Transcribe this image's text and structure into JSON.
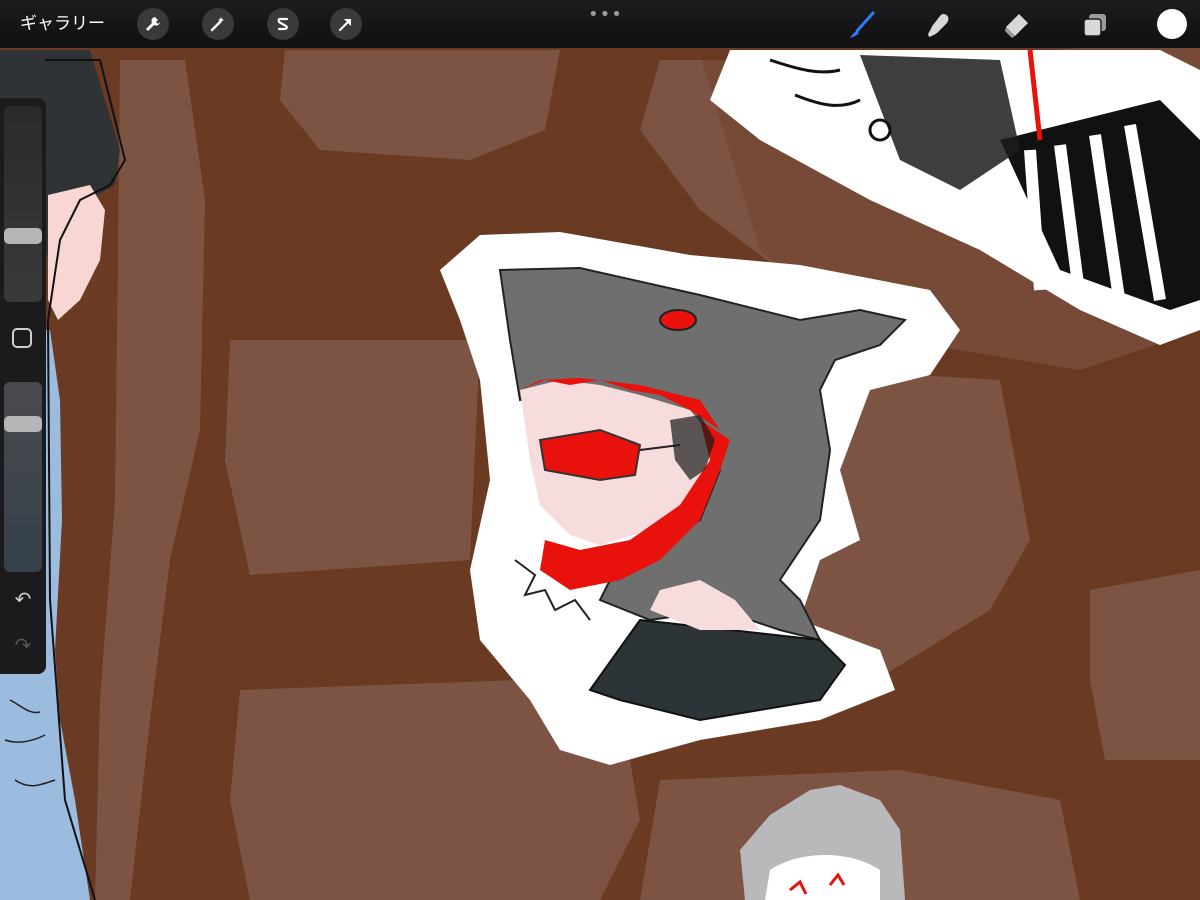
{
  "toolbar": {
    "gallery_label": "ギャラリー",
    "left_tools": [
      "wrench-icon",
      "magic-wand-icon",
      "selection-s-icon",
      "transform-arrow-icon"
    ],
    "center_icon": "more-dots-icon",
    "right_tools": [
      "brush-icon",
      "smudge-icon",
      "eraser-icon",
      "layers-icon"
    ],
    "active_tool": "brush",
    "current_color": "#ffffff"
  },
  "sidebar": {
    "controls": [
      "brush-size-slider",
      "modify-button",
      "opacity-slider",
      "undo-button",
      "redo-button"
    ],
    "brush_size_level": 0.3,
    "opacity_level": 0.2
  },
  "colors": {
    "background_dark": "#6b3a22",
    "background_light": "#7d5443",
    "accent_blue": "#2f7df6",
    "sticker_red": "#e8110c",
    "shark_gray": "#6f6f6f"
  }
}
